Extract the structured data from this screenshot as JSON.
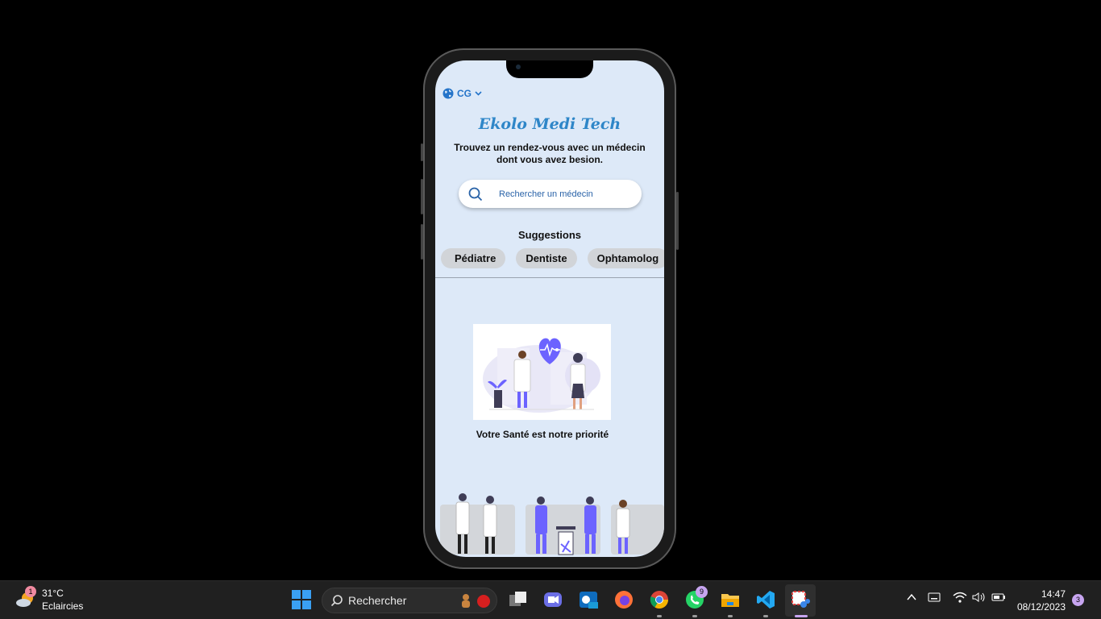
{
  "app": {
    "language_code": "CG",
    "logo_text": "Ekolo Medi Tech",
    "tagline": "Trouvez un rendez-vous avec un médecin dont vous avez besion.",
    "search": {
      "placeholder": "Rechercher un médecin"
    },
    "suggestions_title": "Suggestions",
    "suggestions": [
      "Pédiatre",
      "Dentiste",
      "Ophtamolog"
    ],
    "priority_caption": "Votre Santé est notre priorité"
  },
  "taskbar": {
    "weather": {
      "temperature": "31°C",
      "condition": "Eclaircies",
      "badge": "1"
    },
    "search_label": "Rechercher",
    "whatsapp_badge": "9",
    "clock": {
      "time": "14:47",
      "date": "08/12/2023"
    },
    "notification_count": "3"
  },
  "colors": {
    "accent": "#2474c9",
    "screen_bg": "#dde9f8",
    "illustration_purple": "#6c63ff",
    "taskbar": "#202020"
  }
}
